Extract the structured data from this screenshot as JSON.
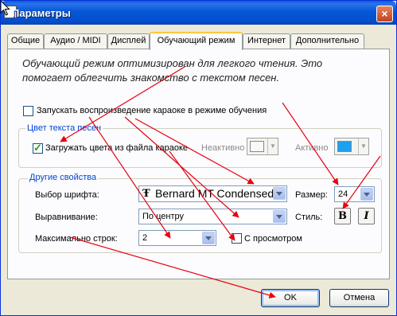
{
  "window": {
    "title": "Параметры",
    "close_symbol": "×"
  },
  "tabs": [
    {
      "label": "Общие"
    },
    {
      "label": "Аудио / MIDI"
    },
    {
      "label": "Дисплей"
    },
    {
      "label": "Обучающий режим",
      "active": true
    },
    {
      "label": "Интернет"
    },
    {
      "label": "Дополнительно"
    }
  ],
  "description": "Обучающий режим оптимизирован для легкого чтения. Это помогает облегчить знакомство с текстом песен.",
  "start_karaoke": {
    "label": "Запускать воспроизведение караоке в режиме обучения",
    "checked": false
  },
  "lyrics_color": {
    "title": "Цвет текста песен",
    "load_colors": {
      "label": "Загружать цвета из файла караоке",
      "checked": true
    },
    "inactive": {
      "label": "Неактивно",
      "color": "#f8f8f8"
    },
    "active": {
      "label": "Активно",
      "color": "#1ea0f0"
    }
  },
  "other_props": {
    "title": "Другие свойства",
    "font": {
      "label": "Выбор шрифта:",
      "value": "Bernard MT Condensed",
      "icon": "truetype-icon"
    },
    "size": {
      "label": "Размер:",
      "value": "24"
    },
    "alignment": {
      "label": "Выравнивание:",
      "value": "По центру"
    },
    "style": {
      "label": "Стиль:",
      "bold": "B",
      "italic": "I"
    },
    "max_lines": {
      "label": "Максимально строк:",
      "value": "2"
    },
    "preview": {
      "label": "С просмотром",
      "checked": false
    }
  },
  "buttons": {
    "ok": "OK",
    "cancel": "Отмена"
  },
  "colors": {
    "annotation_arrow": "#e8000e",
    "titlebar": "#0556d6",
    "tab_highlight": "#ffc83c"
  }
}
